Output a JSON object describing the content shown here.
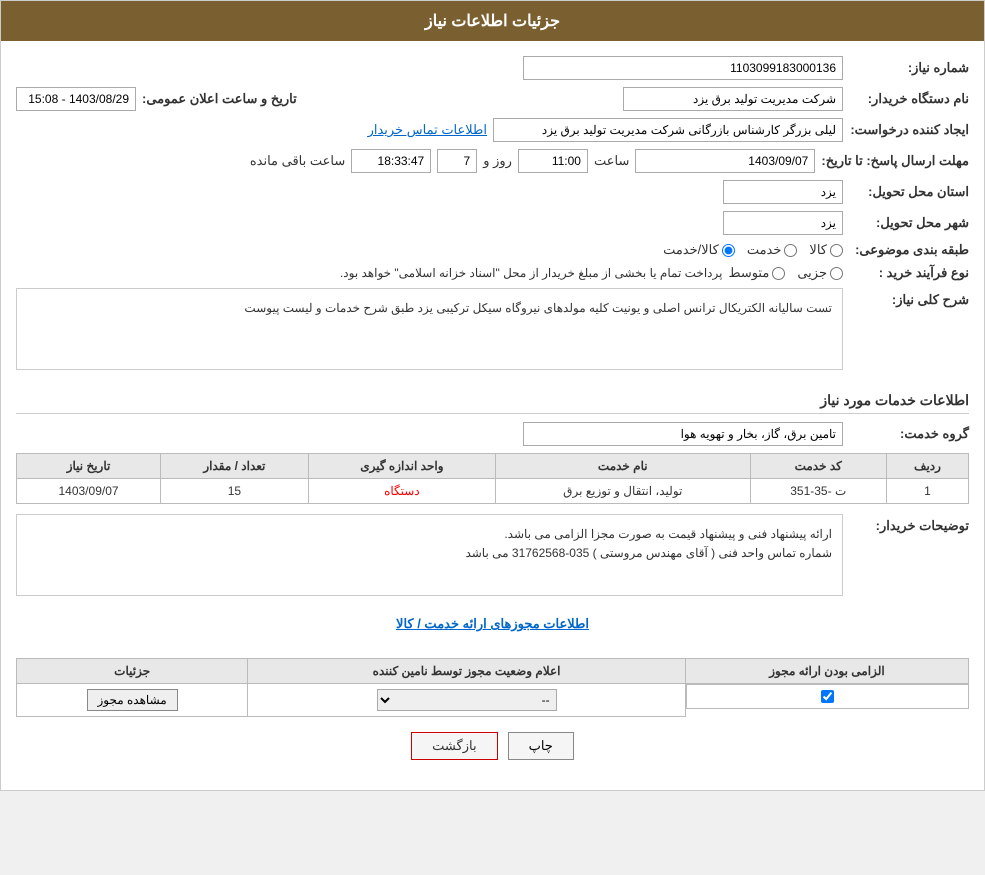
{
  "header": {
    "title": "جزئیات اطلاعات نیاز"
  },
  "fields": {
    "shomara_niaz_label": "شماره نیاز:",
    "shomara_niaz_value": "1103099183000136",
    "nam_dastgah_label": "نام دستگاه خریدار:",
    "nam_dastgah_value": "شرکت مدیریت تولید برق یزد",
    "ejad_konande_label": "ایجاد کننده درخواست:",
    "ejad_konande_value": "لیلی بزرگر کارشناس بازرگانی شرکت مدیریت تولید برق یزد",
    "ettelaat_tamas_label": "اطلاعات تماس خریدار",
    "mohlat_label": "مهلت ارسال پاسخ: تا تاریخ:",
    "mohlat_date": "1403/09/07",
    "mohlat_saat_label": "ساعت",
    "mohlat_saat": "11:00",
    "mohlat_roz_label": "روز و",
    "mohlat_roz": "7",
    "mohlat_baqi_label": "ساعت باقی مانده",
    "mohlat_baqi": "18:33:47",
    "tarikh_label": "تاریخ و ساعت اعلان عمومی:",
    "tarikh_value": "1403/08/29 - 15:08",
    "ostan_label": "استان محل تحویل:",
    "ostan_value": "یزد",
    "shahr_label": "شهر محل تحویل:",
    "shahr_value": "یزد",
    "tabaqe_label": "طبقه بندی موضوعی:",
    "kala_label": "کالا",
    "khedmat_label": "خدمت",
    "kala_khedmat_label": "کالا/خدمت",
    "navae_label": "نوع فرآیند خرید :",
    "jozi_label": "جزیی",
    "motavaset_label": "متوسط",
    "notice_text": "پرداخت تمام یا بخشی از مبلغ خریدار از محل \"اسناد خزانه اسلامی\" خواهد بود.",
    "sharh_label": "شرح کلی نیاز:",
    "sharh_value": "تست سالیانه الکتریکال  ترانس اصلی و یونیت کلیه مولدهای نیروگاه سیکل ترکیبی یزد طبق شرح خدمات و لیست پیوست",
    "ettelaat_section": "اطلاعات خدمات مورد نیاز",
    "grouh_label": "گروه خدمت:",
    "grouh_value": "تامین برق، گاز، بخار و تهویه هوا"
  },
  "table": {
    "headers": [
      "ردیف",
      "کد خدمت",
      "نام خدمت",
      "واحد اندازه گیری",
      "تعداد / مقدار",
      "تاریخ نیاز"
    ],
    "rows": [
      {
        "radif": "1",
        "kod": "ت -35-351",
        "name": "تولید، انتقال و توزیع برق",
        "vahed": "دستگاه",
        "tedad": "15",
        "tarikh": "1403/09/07"
      }
    ]
  },
  "buyer_notes_label": "توضیحات خریدار:",
  "buyer_notes": "ارائه پیشنهاد فنی و پیشنهاد قیمت به صورت مجزا الزامی می باشد.\nشماره تماس واحد فنی ( آقای مهندس مروستی ) 035-31762568 می باشد",
  "permits_section_title": "اطلاعات مجوزهای ارائه خدمت / کالا",
  "permits_table": {
    "headers": [
      "الزامی بودن ارائه مجوز",
      "اعلام وضعیت مجوز توسط نامین کننده",
      "جزئیات"
    ],
    "rows": [
      {
        "elzami": true,
        "status": "--",
        "details_btn": "مشاهده مجوز"
      }
    ]
  },
  "buttons": {
    "print": "چاپ",
    "back": "بازگشت"
  }
}
